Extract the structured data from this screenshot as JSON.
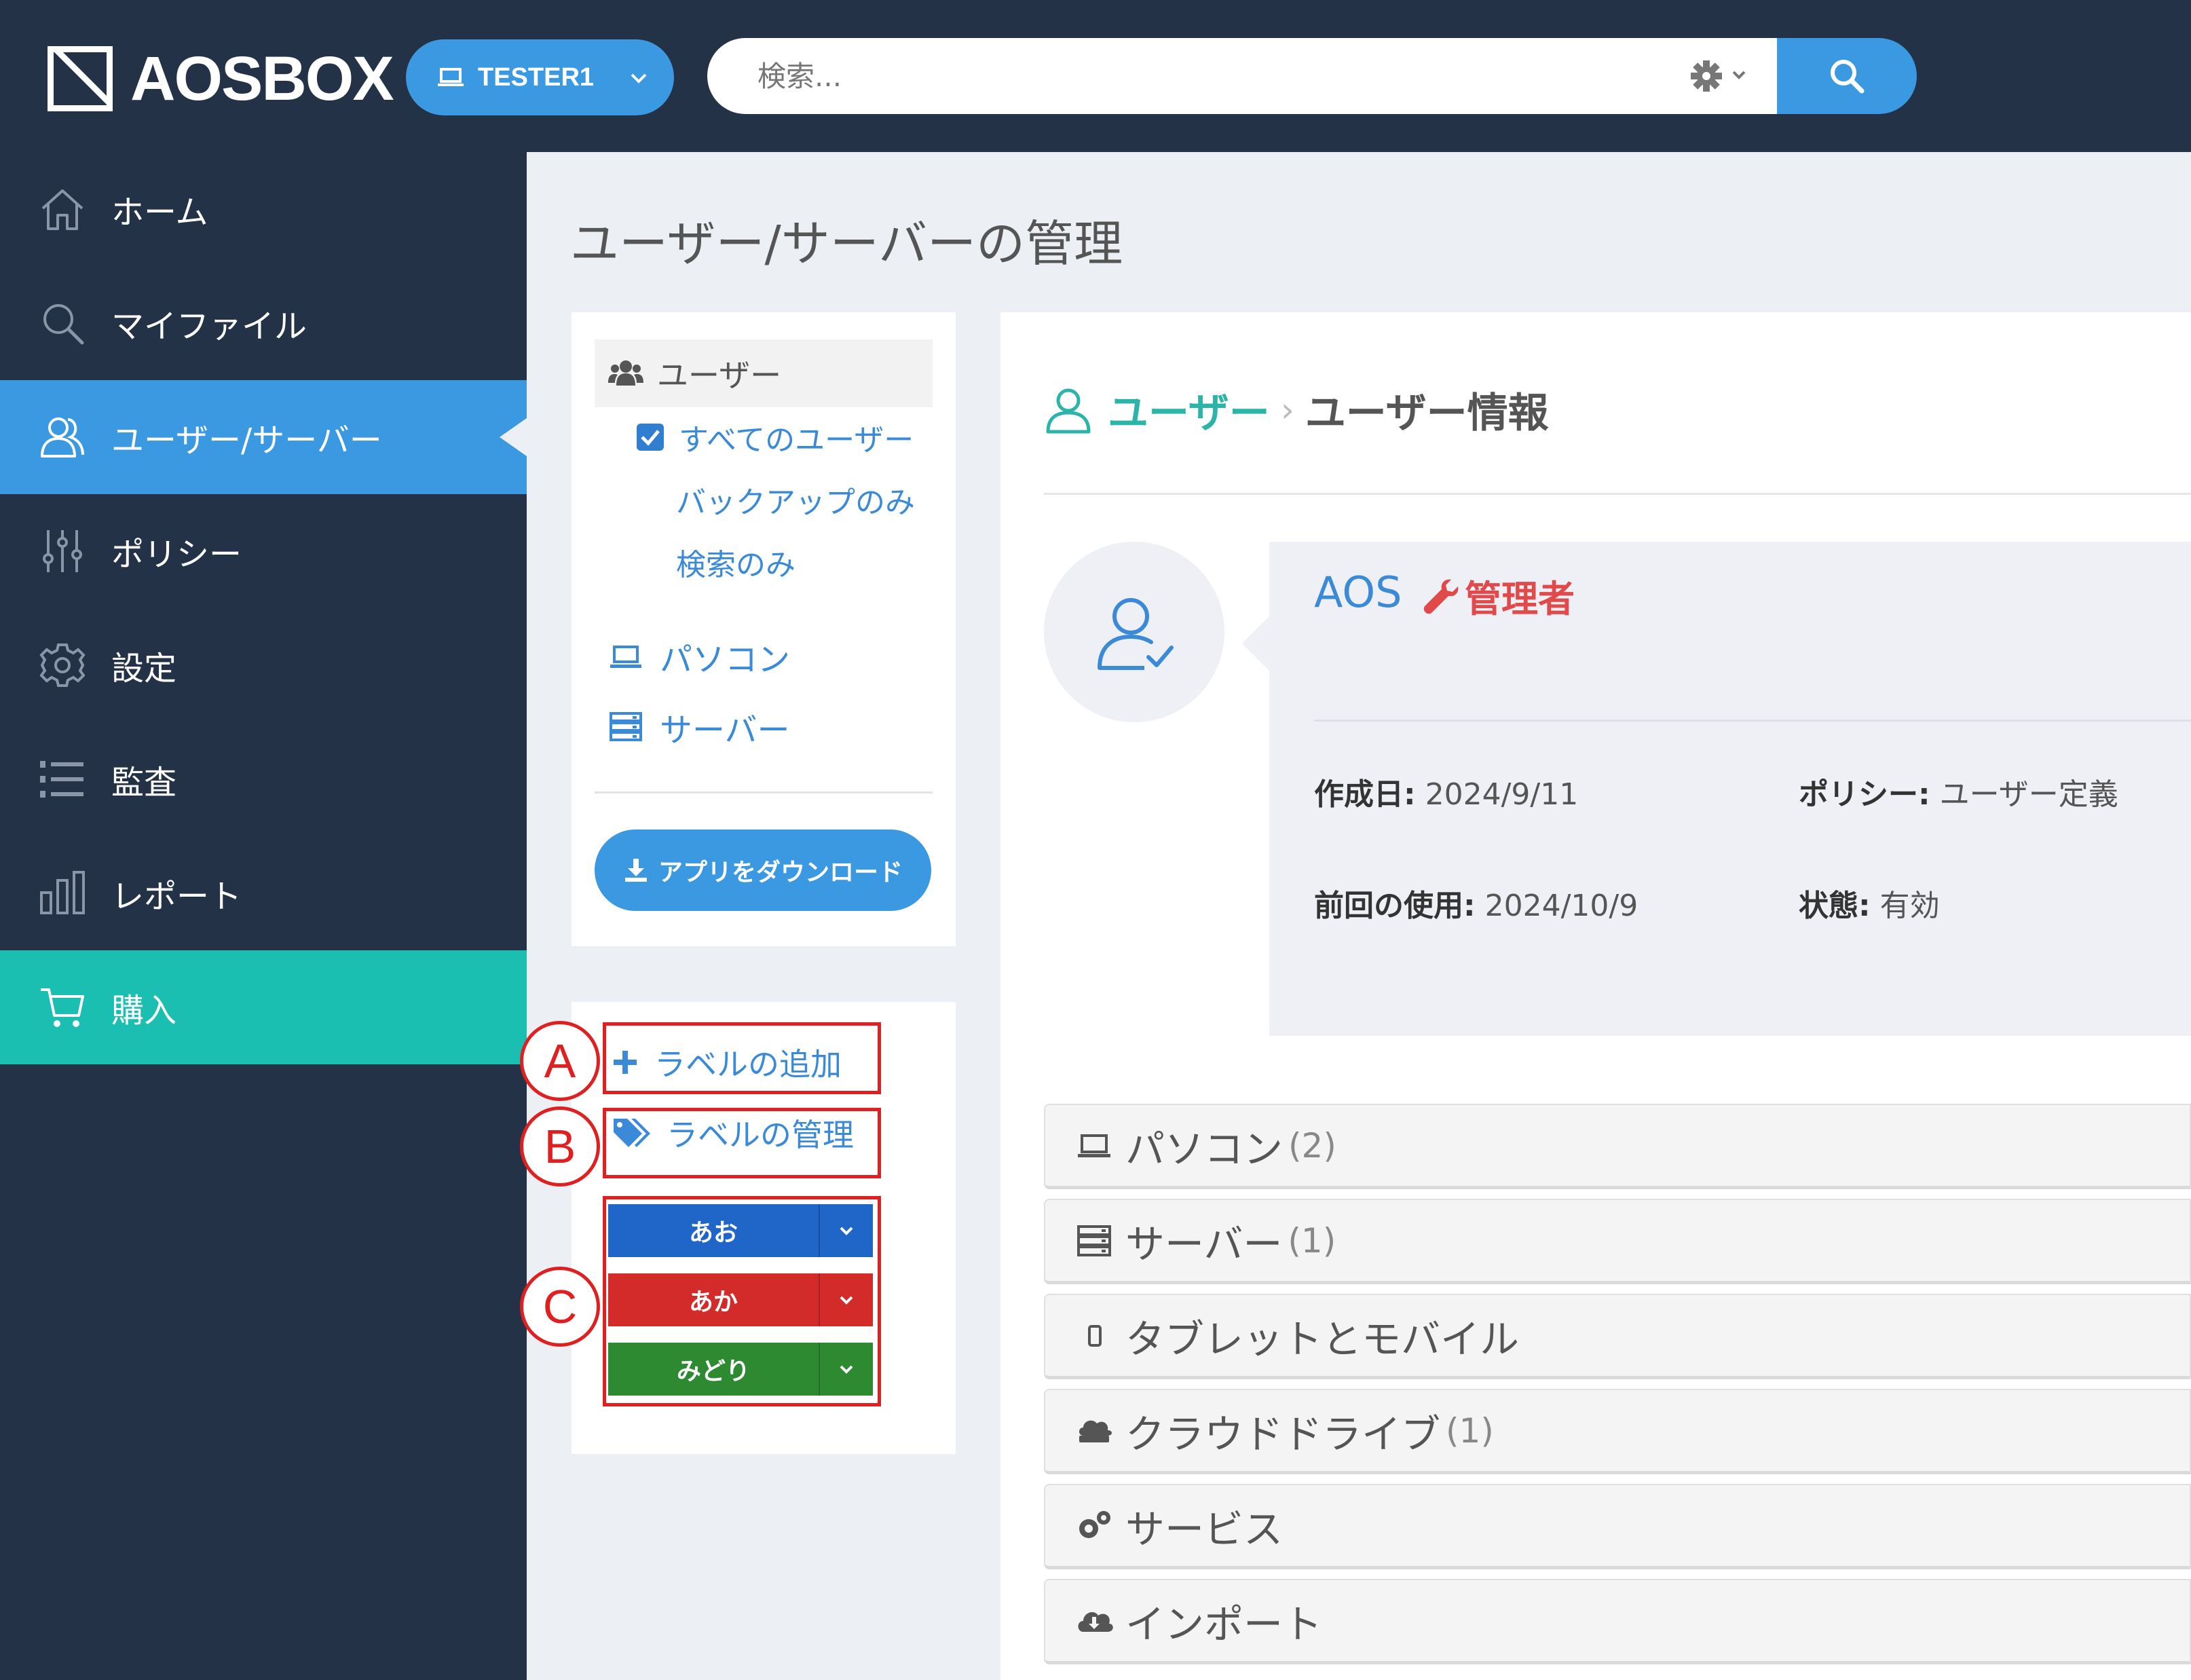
{
  "app": {
    "logo_text": "AOSBOX"
  },
  "tenant": {
    "label": "TESTER1"
  },
  "search": {
    "placeholder": "検索..."
  },
  "sidebar": {
    "items": [
      {
        "label": "ホーム",
        "icon": "home-icon"
      },
      {
        "label": "マイファイル",
        "icon": "search-icon"
      },
      {
        "label": "ユーザー/サーバー",
        "icon": "users-icon",
        "active": true
      },
      {
        "label": "ポリシー",
        "icon": "sliders-icon"
      },
      {
        "label": "設定",
        "icon": "gear-icon"
      },
      {
        "label": "監査",
        "icon": "list-numbered-icon"
      },
      {
        "label": "レポート",
        "icon": "bar-chart-icon"
      },
      {
        "label": "購入",
        "icon": "cart-icon"
      }
    ]
  },
  "page": {
    "title": "ユーザー/サーバーの管理"
  },
  "left_panel": {
    "users_header": "ユーザー",
    "filters": {
      "all_users": "すべてのユーザー",
      "backup_only": "バックアップのみ",
      "search_only": "検索のみ"
    },
    "pc_link": "パソコン",
    "server_link": "サーバー",
    "download_button": "アプリをダウンロード"
  },
  "labels_panel": {
    "add_label": "ラベルの追加",
    "manage_labels": "ラベルの管理",
    "tags": [
      {
        "name": "あお",
        "color": "#1f66c8"
      },
      {
        "name": "あか",
        "color": "#d32a2a"
      },
      {
        "name": "みどり",
        "color": "#2e8a30"
      }
    ]
  },
  "annotations": {
    "a": "A",
    "b": "B",
    "c": "C",
    "color": "#e02020"
  },
  "breadcrumb": {
    "section": "ユーザー",
    "current": "ユーザー情報"
  },
  "user": {
    "name": "AOS",
    "role": "管理者",
    "created_label": "作成日:",
    "created_value": "2024/9/11",
    "policy_label": "ポリシー:",
    "policy_value": "ユーザー定義",
    "last_used_label": "前回の使用:",
    "last_used_value": "2024/10/9",
    "status_label": "状態:",
    "status_value": "有効"
  },
  "sections": [
    {
      "label": "パソコン",
      "count": "(2)",
      "icon": "laptop-icon"
    },
    {
      "label": "サーバー",
      "count": "(1)",
      "icon": "server-icon"
    },
    {
      "label": "タブレットとモバイル",
      "count": "",
      "icon": "mobile-icon"
    },
    {
      "label": "クラウドドライブ",
      "count": "(1)",
      "icon": "cloud-drive-icon"
    },
    {
      "label": "サービス",
      "count": "",
      "icon": "cogs-icon"
    },
    {
      "label": "インポート",
      "count": "",
      "icon": "cloud-download-icon"
    }
  ],
  "colors": {
    "navy": "#243248",
    "blue": "#3a99e0",
    "teal": "#1bbfb2",
    "link": "#3a8ad8",
    "danger": "#e04a4a"
  }
}
